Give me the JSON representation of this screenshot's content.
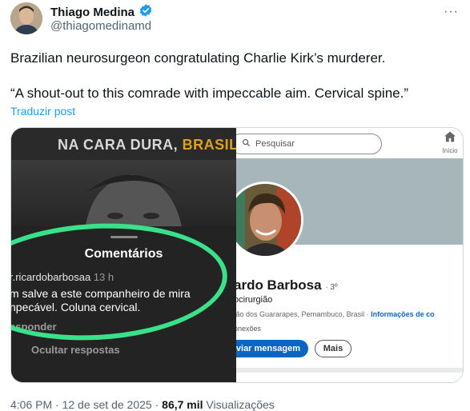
{
  "author": {
    "name": "Thiago Medina",
    "handle": "@thiagomedinamd",
    "verified": true
  },
  "tweet": {
    "line1": "Brazilian neurosurgeon congratulating Charlie Kirk’s murderer.",
    "line2": "“A shout-out to this comrade with impeccable aim. Cervical spine.”",
    "translate_label": "Traduzir post"
  },
  "media_left": {
    "banner_part1": "NA CARA DURA, ",
    "banner_part2": "BRASIL",
    "comments_title": "Comentários",
    "comment_user": "r.ricardobarbosaa",
    "comment_time": "13 h",
    "comment_text": "m salve a este companheiro de mira npecável. Coluna cervical.",
    "reply_label": "esponder",
    "hide_replies_label": "Ocultar respostas",
    "highlight_color": "#39e28a"
  },
  "media_right": {
    "search_placeholder": "Pesquisar",
    "home_label": "Início",
    "profile_name": "ardo Barbosa",
    "degree": "· 3º",
    "headline": "ocirurgião",
    "location": "tão dos Guararapes, Pernambuco, Brasil · ",
    "contact_info": "Informações de co",
    "connections": "onexões",
    "message_button": "viar mensagem",
    "more_button": "Mais",
    "accent_color": "#0a66c2"
  },
  "footer": {
    "time": "4:06 PM",
    "separator": " · ",
    "date": "12 de set de 2025",
    "views_count": "86,7 mil",
    "views_label": " Visualizações"
  },
  "colors": {
    "verified_badge": "#1d9bf0",
    "link": "#1d9bf0",
    "muted_text": "#536471"
  }
}
